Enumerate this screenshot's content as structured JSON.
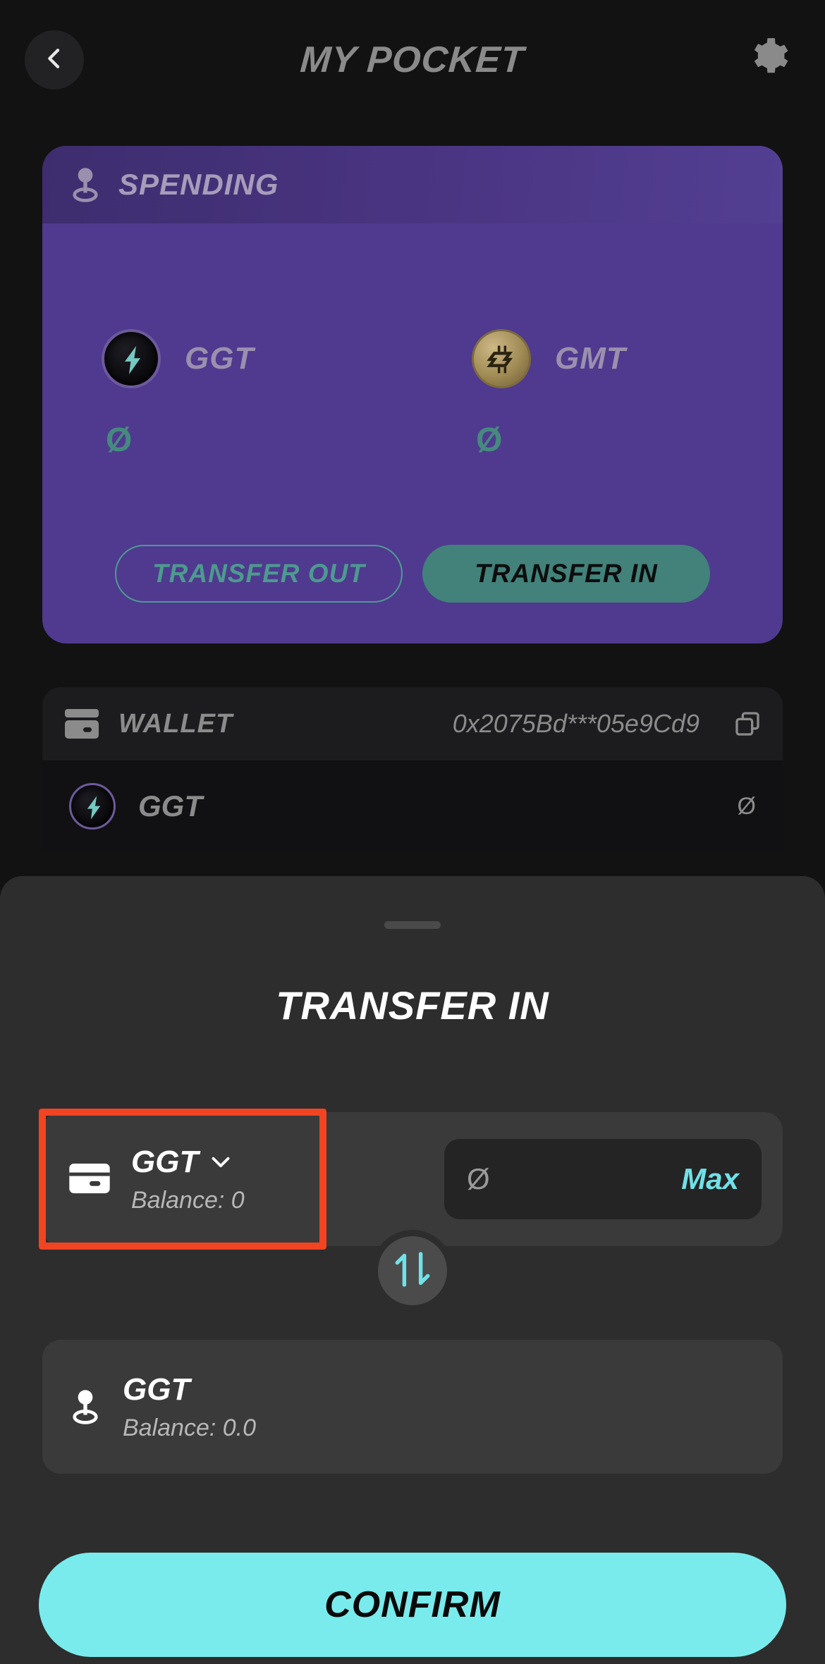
{
  "header": {
    "title": "MY POCKET",
    "back_icon": "chevron-left-icon",
    "settings_icon": "gear-icon"
  },
  "spending": {
    "label": "SPENDING",
    "icon": "joystick-icon",
    "tokens": [
      {
        "symbol": "GGT",
        "balance": "Ø",
        "icon": "ggt-coin-icon"
      },
      {
        "symbol": "GMT",
        "balance": "Ø",
        "icon": "gmt-coin-icon"
      }
    ],
    "transfer_out_label": "TRANSFER OUT",
    "transfer_in_label": "TRANSFER IN"
  },
  "wallet": {
    "label": "WALLET",
    "icon": "wallet-icon",
    "address": "0x2075Bd***05e9Cd9",
    "copy_icon": "copy-icon",
    "rows": [
      {
        "symbol": "GGT",
        "value": "Ø",
        "icon": "ggt-coin-icon"
      }
    ]
  },
  "sheet": {
    "title": "TRANSFER IN",
    "from": {
      "icon": "credit-card-icon",
      "symbol": "GGT",
      "chevron": "chevron-down-icon",
      "balance": "Balance: 0",
      "amount_value": "Ø",
      "max_label": "Max"
    },
    "swap_icon": "swap-vertical-icon",
    "to": {
      "icon": "joystick-icon",
      "symbol": "GGT",
      "balance": "Balance: 0.0"
    },
    "confirm_label": "CONFIRM"
  },
  "colors": {
    "accent_cyan": "#7aebec",
    "spending_purple": "#4f3a8f",
    "teal": "#42827a",
    "highlight_red": "#f04423",
    "sheet_bg": "#2d2d2d"
  }
}
